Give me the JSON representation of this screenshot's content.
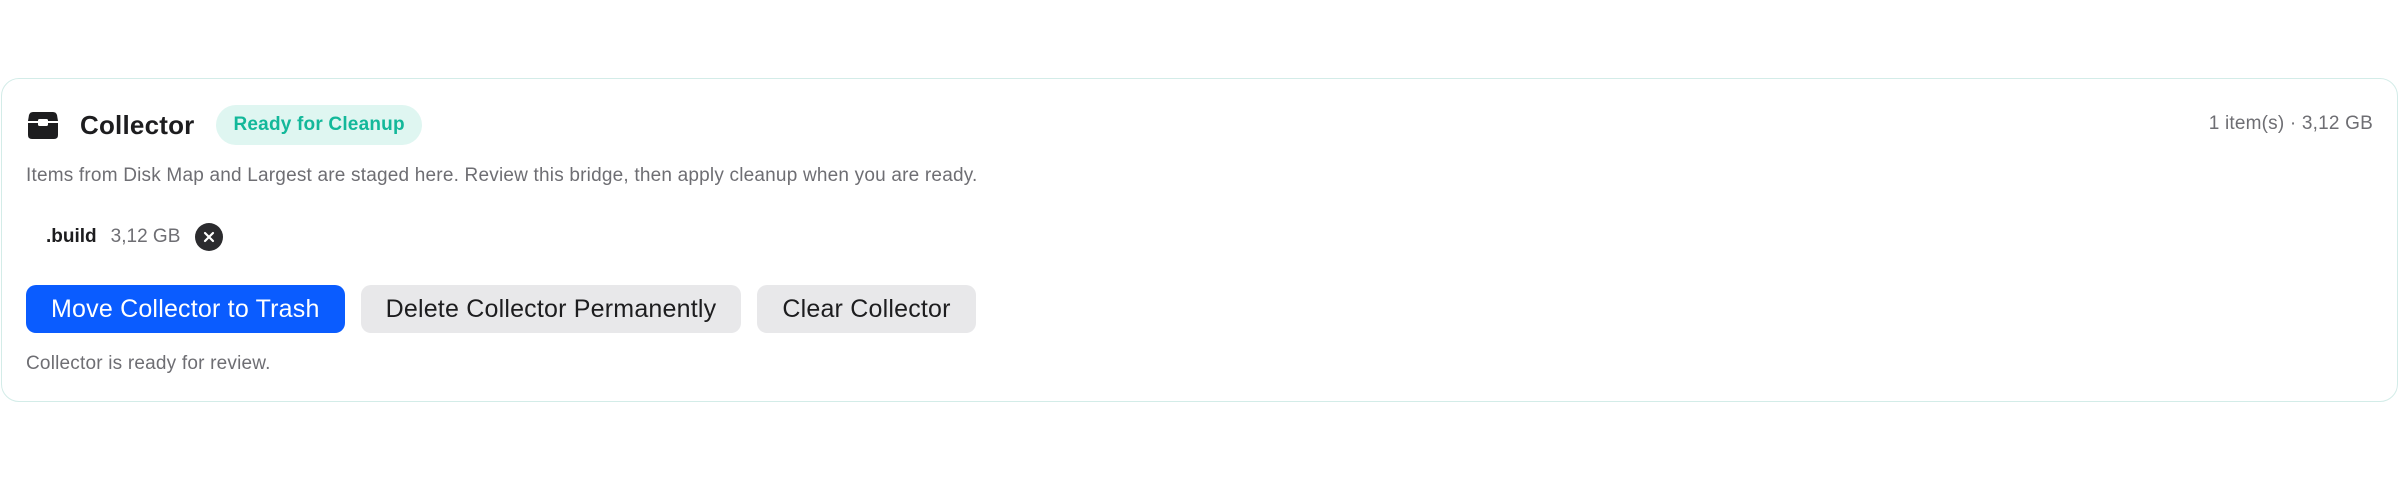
{
  "collector": {
    "title": "Collector",
    "badge": "Ready for Cleanup",
    "summary": "1 item(s) · 3,12 GB",
    "description": "Items from Disk Map and Largest are staged here. Review this bridge, then apply cleanup when you are ready.",
    "icon": "archive-box-icon",
    "items": [
      {
        "name": ".build",
        "size": "3,12 GB"
      }
    ],
    "actions": {
      "trash_label": "Move Collector to Trash",
      "delete_label": "Delete Collector Permanently",
      "clear_label": "Clear Collector"
    },
    "status": "Collector is ready for review."
  },
  "colors": {
    "accent": "#0a5cff",
    "badge_text": "#13b89a",
    "badge_bg": "#dff6f1",
    "card_border": "#d3ece8"
  }
}
